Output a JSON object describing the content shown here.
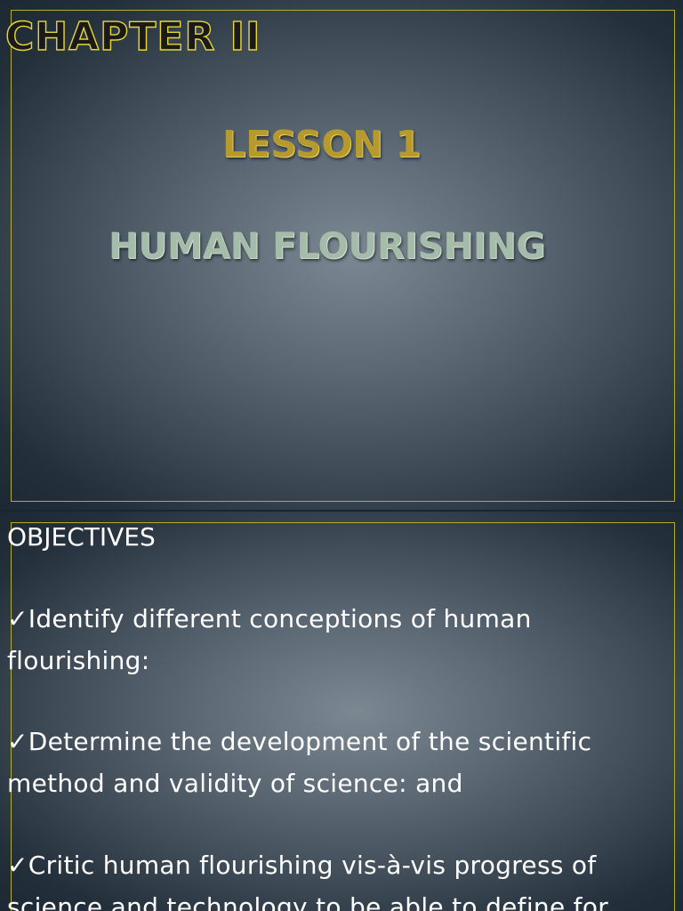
{
  "slide1": {
    "chapter": "CHAPTER II",
    "lesson": "LESSON 1",
    "topic": "HUMAN FLOURISHING"
  },
  "slide2": {
    "heading": "OBJECTIVES",
    "check_glyph": "✓",
    "objectives": [
      {
        "line1": "Identify different conceptions of human",
        "line2": "flourishing:"
      },
      {
        "line1": "Determine the development of the scientific",
        "line2": "method and validity of science: and"
      },
      {
        "line1": "Critic human flourishing vis-à-vis progress of",
        "line2": "science and technology to be able to define for"
      }
    ]
  },
  "colors": {
    "frame_border": "#b7ab2c",
    "chapter_outline": "#e6d63a",
    "lesson_gold": "#b69a2e",
    "topic_sage": "#a6bcaa",
    "body_text": "#ffffff"
  }
}
